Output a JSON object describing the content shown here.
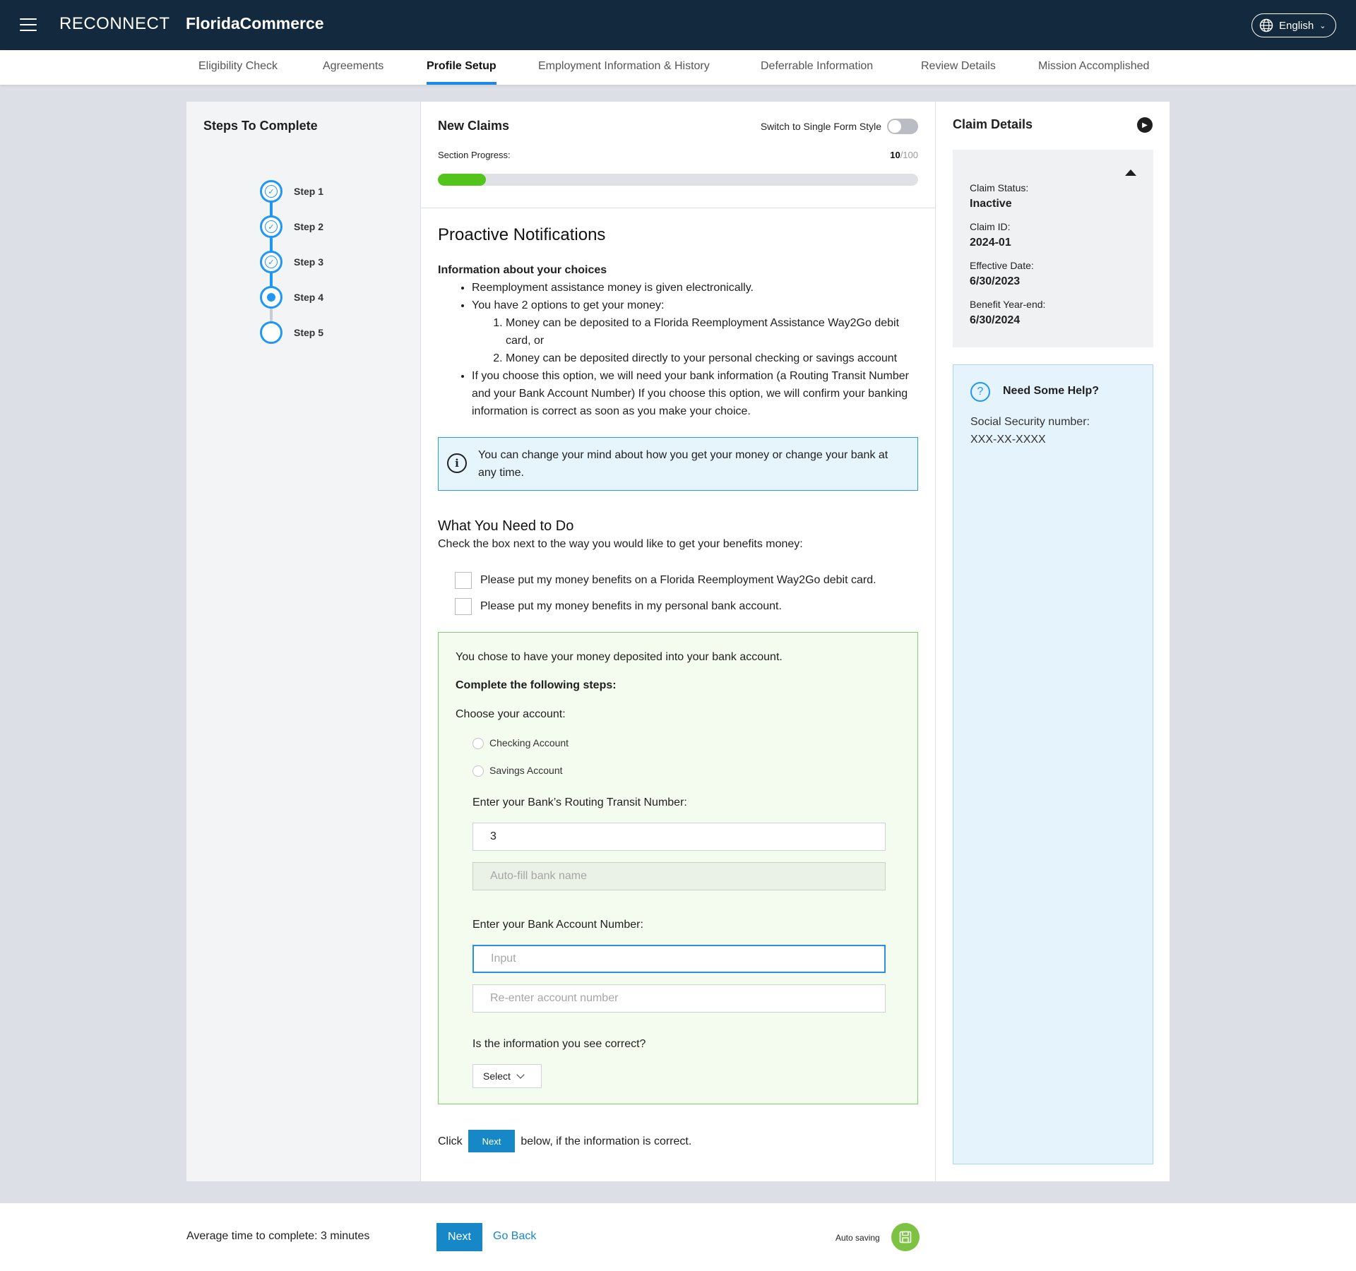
{
  "header": {
    "logo": "RECONNECT",
    "brand": "FloridaCommerce",
    "language": "English"
  },
  "tabs": [
    {
      "label": "Eligibility Check",
      "active": false
    },
    {
      "label": "Agreements",
      "active": false
    },
    {
      "label": "Profile Setup",
      "active": true
    },
    {
      "label": "Employment Information & History",
      "active": false
    },
    {
      "label": "Deferrable Information",
      "active": false
    },
    {
      "label": "Review Details",
      "active": false
    },
    {
      "label": "Mission Accomplished",
      "active": false
    }
  ],
  "steps_panel": {
    "title": "Steps To Complete",
    "steps": [
      {
        "label": "Step 1",
        "state": "complete"
      },
      {
        "label": "Step 2",
        "state": "complete"
      },
      {
        "label": "Step 3",
        "state": "complete"
      },
      {
        "label": "Step 4",
        "state": "current"
      },
      {
        "label": "Step 5",
        "state": "pending"
      }
    ]
  },
  "form_header": {
    "title": "New Claims",
    "switch_label": "Switch to Single Form Style",
    "switch_on": false,
    "progress_label": "Section Progress:",
    "progress_value": "10",
    "progress_total": "/100",
    "progress_fraction": 0.1
  },
  "content": {
    "title": "Proactive Notifications",
    "info_heading": "Information about your choices",
    "bullet_1": "Reemployment assistance money is given electronically.",
    "bullet_2": "You have 2 options to get your money:",
    "option_1": "Money can be deposited to a Florida Reemployment Assistance Way2Go debit card, or",
    "option_2": "Money can be deposited directly to your personal checking or savings account",
    "bullet_3": "If you choose this option, we will need your bank information (a Routing Transit Number and your Bank Account Number) If you choose this option, we will confirm your banking information is correct as soon as you make your choice.",
    "info_box": "You can change your mind about how you get your money or change your bank at any time.",
    "what_title": "What You Need to Do",
    "what_sub": "Check the box next to the way you would like to get your benefits money:",
    "checkbox_1": "Please put my money benefits on a Florida Reemployment Way2Go debit card.",
    "checkbox_2": "Please put my money benefits in my personal bank account.",
    "green": {
      "chose": "You chose to have your money deposited into your bank account.",
      "complete": "Complete the following steps:",
      "choose_account": "Choose your account:",
      "radio_1": "Checking Account",
      "radio_2": "Savings Account",
      "routing_label": "Enter your Bank’s Routing Transit Number:",
      "routing_value": "3",
      "bank_name_placeholder": "Auto-fill bank name",
      "account_label": "Enter your Bank Account Number:",
      "account_placeholder": "Input",
      "reenter_placeholder": "Re-enter account number",
      "correct_label": "Is the information you see correct?",
      "select_label": "Select"
    },
    "click_pre": "Click",
    "click_button": "Next",
    "click_post": "below, if the information is correct."
  },
  "claim_details": {
    "title": "Claim Details",
    "status_label": "Claim Status:",
    "status_value": "Inactive",
    "id_label": "Claim ID:",
    "id_value": "2024-01",
    "effective_label": "Effective Date:",
    "effective_value": "6/30/2023",
    "yearend_label": "Benefit Year-end:",
    "yearend_value": "6/30/2024"
  },
  "help": {
    "title": "Need Some Help?",
    "ssn_label": "Social Security number:",
    "ssn_value": "XXX-XX-XXXX"
  },
  "footer": {
    "avg_time": "Average time to complete: 3 minutes",
    "next": "Next",
    "go_back": "Go Back",
    "auto_saving": "Auto saving"
  },
  "colors": {
    "header_bg": "#13293d",
    "accent": "#2196f3",
    "button": "#1788c7",
    "progress": "#52c41a"
  }
}
